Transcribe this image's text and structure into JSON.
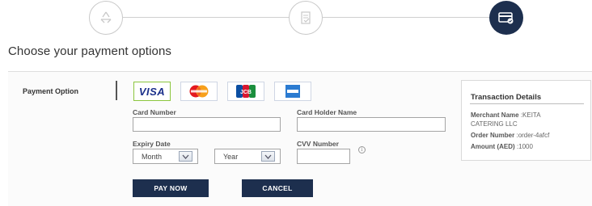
{
  "stepper": {
    "steps": [
      {
        "icon": "recycle-icon",
        "state": "done"
      },
      {
        "icon": "document-check-icon",
        "state": "done"
      },
      {
        "icon": "credit-card-check-icon",
        "state": "active"
      }
    ]
  },
  "page": {
    "title": "Choose your payment options"
  },
  "payment": {
    "option_label": "Payment Option",
    "cards": [
      {
        "name": "VISA",
        "selected": true
      },
      {
        "name": "Mastercard",
        "selected": false
      },
      {
        "name": "JCB",
        "selected": false
      },
      {
        "name": "American Express",
        "selected": false
      }
    ]
  },
  "form": {
    "card_number_label": "Card Number",
    "card_holder_label": "Card Holder Name",
    "expiry_label": "Expiry Date",
    "month_value": "Month",
    "year_value": "Year",
    "cvv_label": "CVV Number",
    "card_number_value": "",
    "card_holder_value": "",
    "cvv_value": "",
    "info_icon_glyph": "i"
  },
  "buttons": {
    "pay": "PAY NOW",
    "cancel": "CANCEL"
  },
  "transaction": {
    "title": "Transaction Details",
    "merchant_label": "Merchant Name",
    "merchant_value": ":KEITA",
    "merchant_value_cont": "CATERING LLC",
    "order_label": "Order Number",
    "order_value": ":order-4afcf",
    "amount_label": "Amount (AED)",
    "amount_value": ":1000"
  },
  "colors": {
    "primary": "#1d2f4e",
    "selected_border": "#8cc63e"
  }
}
